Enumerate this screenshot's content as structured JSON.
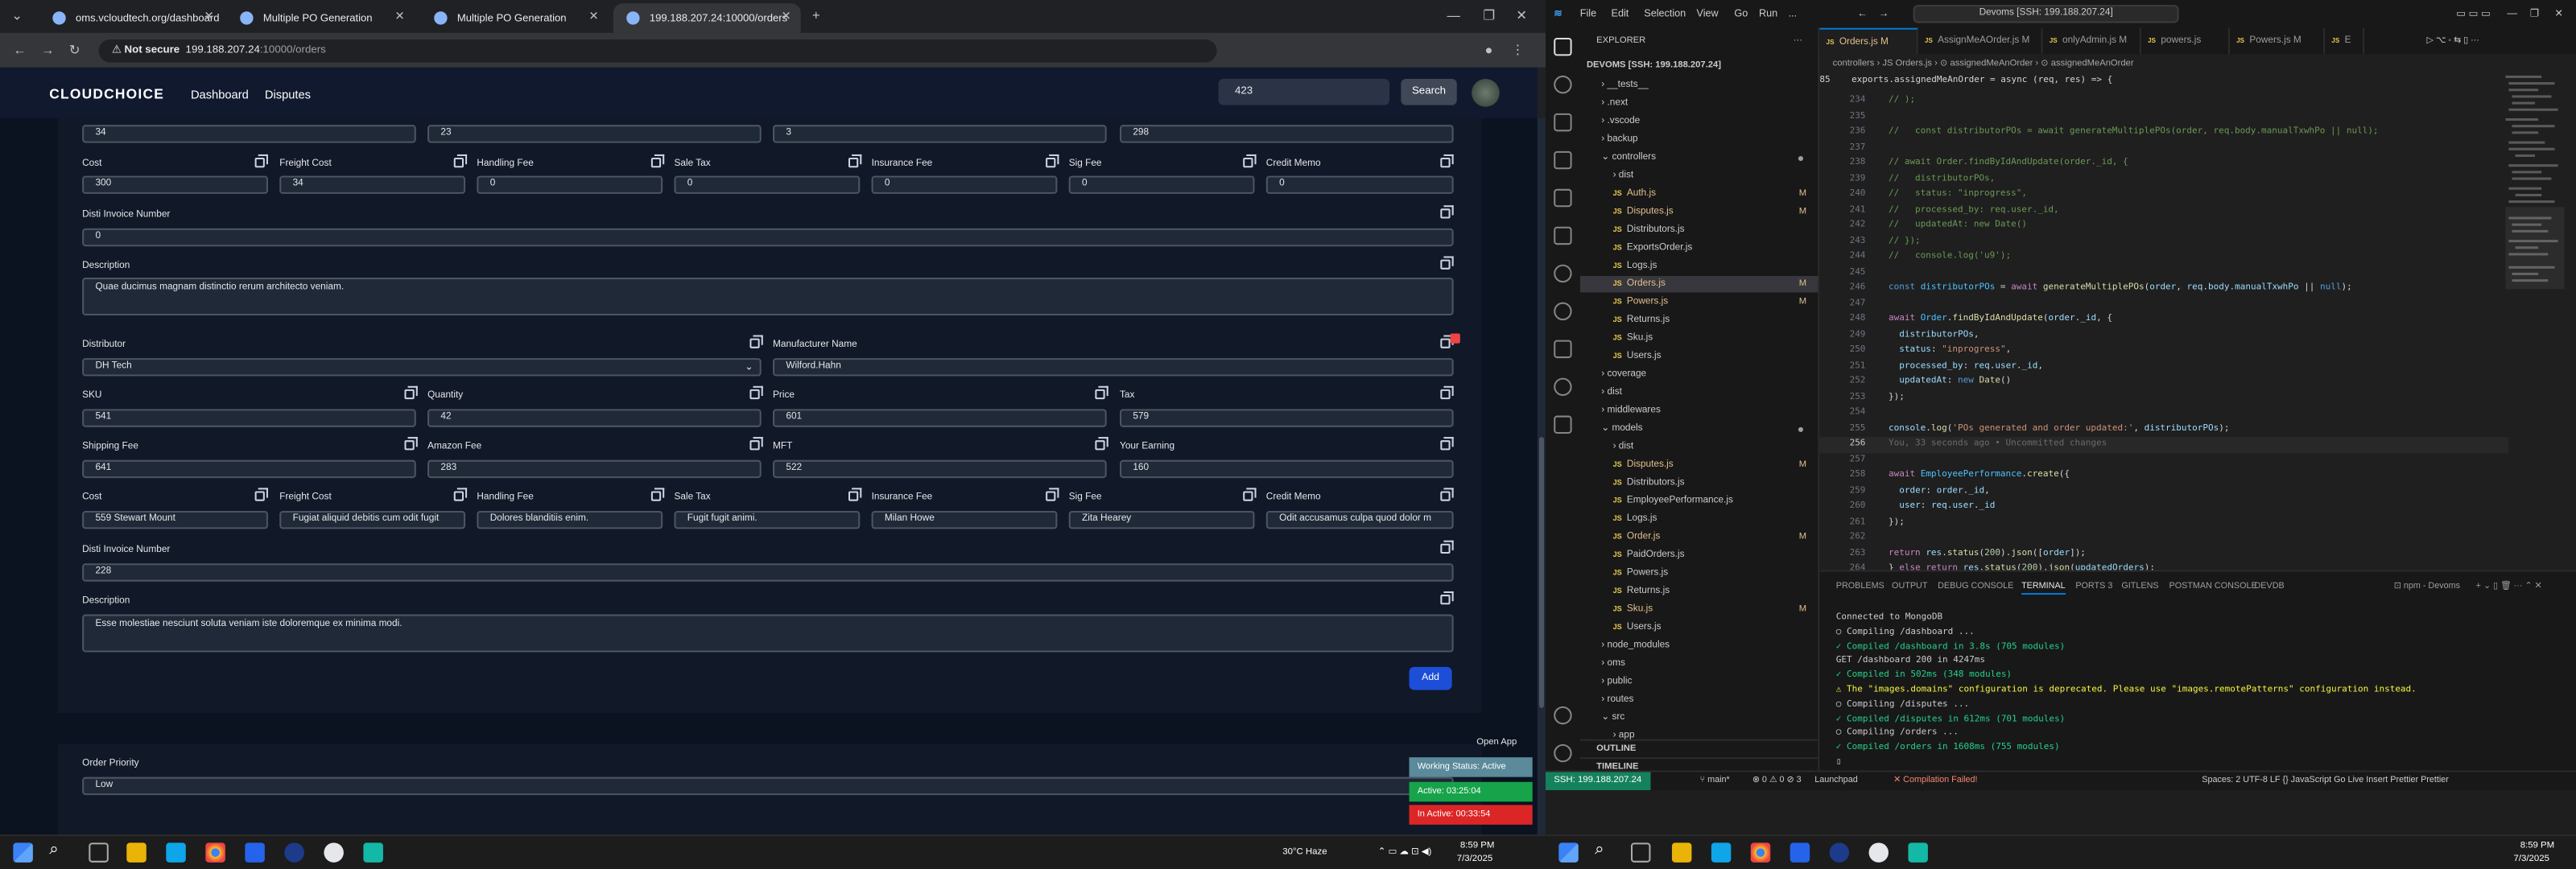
{
  "browser": {
    "tabs": [
      {
        "label": "oms.vcloudtech.org/dashboard"
      },
      {
        "label": "Multiple PO Generation"
      },
      {
        "label": "Multiple PO Generation"
      },
      {
        "label": "199.188.207.24:10000/orders"
      }
    ],
    "security": "Not secure",
    "url_host": "199.188.207.24",
    "url_path": ":10000/orders"
  },
  "app": {
    "logo": "CLOUDCHOICE",
    "nav": [
      "Dashboard",
      "Disputes"
    ],
    "search_value": "423",
    "search_button": "Search",
    "labels": {
      "cost": "Cost",
      "freight": "Freight Cost",
      "handling": "Handling Fee",
      "sale_tax": "Sale Tax",
      "insurance": "Insurance Fee",
      "sig": "Sig Fee",
      "credit": "Credit Memo",
      "disti_invoice": "Disti Invoice Number",
      "description": "Description",
      "distributor": "Distributor",
      "manufacturer": "Manufacturer Name",
      "sku": "SKU",
      "quantity": "Quantity",
      "price": "Price",
      "tax": "Tax",
      "shipping": "Shipping Fee",
      "amazon": "Amazon Fee",
      "mft": "MFT",
      "earning": "Your Earning",
      "order_priority": "Order Priority"
    },
    "item1": {
      "top_row": [
        "34",
        "23",
        "3",
        "298"
      ],
      "fees": [
        "300",
        "34",
        "0",
        "0",
        "0",
        "0",
        "0"
      ],
      "disti_invoice": "0",
      "description": "Quae ducimus magnam distinctio rerum architecto veniam."
    },
    "item2": {
      "distributor": "DH Tech",
      "manufacturer": "Wilford.Hahn",
      "sku": "541",
      "quantity": "42",
      "price": "601",
      "tax": "579",
      "shipping": "641",
      "amazon": "283",
      "mft": "522",
      "earning": "160",
      "fees": [
        "559 Stewart Mount",
        "Fugiat aliquid debitis cum odit fugit",
        "Dolores blanditiis enim.",
        "Fugit fugit animi.",
        "Milan Howe",
        "Zita Hearey",
        "Odit accusamus culpa quod dolor m"
      ],
      "disti_invoice": "228",
      "description": "Esse molestiae nesciunt soluta veniam iste doloremque ex minima modi."
    },
    "add_button": "Add",
    "order_priority": "Low",
    "working": {
      "open_app": "Open App",
      "status": "Working Status: Active",
      "active": "Active: 03:25:04",
      "inactive": "In Active: 00:33:54"
    }
  },
  "taskbar_left": {
    "weather": "30°C  Haze",
    "time": "8:59 PM",
    "date": "7/3/2025"
  },
  "taskbar_right": {
    "time": "8:59 PM",
    "date": "7/3/2025"
  },
  "vscode": {
    "menu": [
      "File",
      "Edit",
      "Selection",
      "View",
      "Go",
      "Run",
      "..."
    ],
    "search": "Devoms [SSH: 199.188.207.24]",
    "explorer_title": "EXPLORER",
    "workspace": "DEVOMS [SSH: 199.188.207.24]",
    "tree": [
      {
        "name": "__tests__",
        "type": "folder",
        "indent": 1
      },
      {
        "name": ".next",
        "type": "folder",
        "indent": 1
      },
      {
        "name": ".vscode",
        "type": "folder",
        "indent": 1
      },
      {
        "name": "backup",
        "type": "folder",
        "indent": 1
      },
      {
        "name": "controllers",
        "type": "folder-open",
        "indent": 1,
        "mod": true
      },
      {
        "name": "dist",
        "type": "folder",
        "indent": 2
      },
      {
        "name": "Auth.js",
        "type": "js",
        "indent": 2,
        "badge": "M"
      },
      {
        "name": "Disputes.js",
        "type": "js",
        "indent": 2,
        "badge": "M"
      },
      {
        "name": "Distributors.js",
        "type": "js",
        "indent": 2
      },
      {
        "name": "ExportsOrder.js",
        "type": "js",
        "indent": 2
      },
      {
        "name": "Logs.js",
        "type": "js",
        "indent": 2
      },
      {
        "name": "Orders.js",
        "type": "js",
        "indent": 2,
        "badge": "M",
        "selected": true
      },
      {
        "name": "Powers.js",
        "type": "js",
        "indent": 2,
        "badge": "M"
      },
      {
        "name": "Returns.js",
        "type": "js",
        "indent": 2
      },
      {
        "name": "Sku.js",
        "type": "js",
        "indent": 2
      },
      {
        "name": "Users.js",
        "type": "js",
        "indent": 2
      },
      {
        "name": "coverage",
        "type": "folder",
        "indent": 1
      },
      {
        "name": "dist",
        "type": "folder",
        "indent": 1
      },
      {
        "name": "middlewares",
        "type": "folder",
        "indent": 1
      },
      {
        "name": "models",
        "type": "folder-open",
        "indent": 1,
        "mod": true
      },
      {
        "name": "dist",
        "type": "folder",
        "indent": 2
      },
      {
        "name": "Disputes.js",
        "type": "js",
        "indent": 2,
        "badge": "M"
      },
      {
        "name": "Distributors.js",
        "type": "js",
        "indent": 2
      },
      {
        "name": "EmployeePerformance.js",
        "type": "js",
        "indent": 2
      },
      {
        "name": "Logs.js",
        "type": "js",
        "indent": 2
      },
      {
        "name": "Order.js",
        "type": "js",
        "indent": 2,
        "badge": "M"
      },
      {
        "name": "PaidOrders.js",
        "type": "js",
        "indent": 2
      },
      {
        "name": "Powers.js",
        "type": "js",
        "indent": 2
      },
      {
        "name": "Returns.js",
        "type": "js",
        "indent": 2
      },
      {
        "name": "Sku.js",
        "type": "js",
        "indent": 2,
        "badge": "M"
      },
      {
        "name": "Users.js",
        "type": "js",
        "indent": 2
      },
      {
        "name": "node_modules",
        "type": "folder",
        "indent": 1
      },
      {
        "name": "oms",
        "type": "folder",
        "indent": 1
      },
      {
        "name": "public",
        "type": "folder",
        "indent": 1
      },
      {
        "name": "routes",
        "type": "folder",
        "indent": 1
      },
      {
        "name": "src",
        "type": "folder-open",
        "indent": 1
      },
      {
        "name": "app",
        "type": "folder",
        "indent": 2
      }
    ],
    "outline": "OUTLINE",
    "timeline": "TIMELINE",
    "tabs": [
      "Orders.js M",
      "AssignMeAOrder.js M",
      "onlyAdmin.js M",
      "powers.js",
      "Powers.js M",
      "E"
    ],
    "breadcrumbs": "controllers  ›  JS Orders.js  ›  ⊙ assignedMeAnOrder  ›  ⊙ assignedMeAnOrder",
    "sticky_line": "85    exports.assignedMeAnOrder = async (req, res) => {",
    "panel_tabs": [
      "PROBLEMS",
      "OUTPUT",
      "DEBUG CONSOLE",
      "TERMINAL",
      "PORTS 3",
      "GITLENS",
      "POSTMAN CONSOLE",
      "DEVDB"
    ],
    "terminal_name": "npm - Devoms",
    "terminal": [
      "Connected to MongoDB",
      "○ Compiling /dashboard ...",
      "✓ Compiled /dashboard in 3.8s (705 modules)",
      "GET /dashboard 200 in 4247ms",
      "✓ Compiled in 502ms (348 modules)",
      "⚠ The \"images.domains\" configuration is deprecated. Please use \"images.remotePatterns\" configuration instead.",
      "○ Compiling /disputes ...",
      "✓ Compiled /disputes in 612ms (701 modules)",
      "○ Compiling /orders ...",
      "✓ Compiled /orders in 1608ms (755 modules)"
    ],
    "status": {
      "remote": "SSH: 199.188.207.24",
      "branch": "main*",
      "problems": "⊗ 0 ⚠ 0  ⊘ 3",
      "launchpad": "Launchpad",
      "compile": "✕ Compilation Failed!",
      "right": "Spaces: 2   UTF-8   LF   {} JavaScript   Go Live   Insert   Prettier   Prettier"
    }
  }
}
